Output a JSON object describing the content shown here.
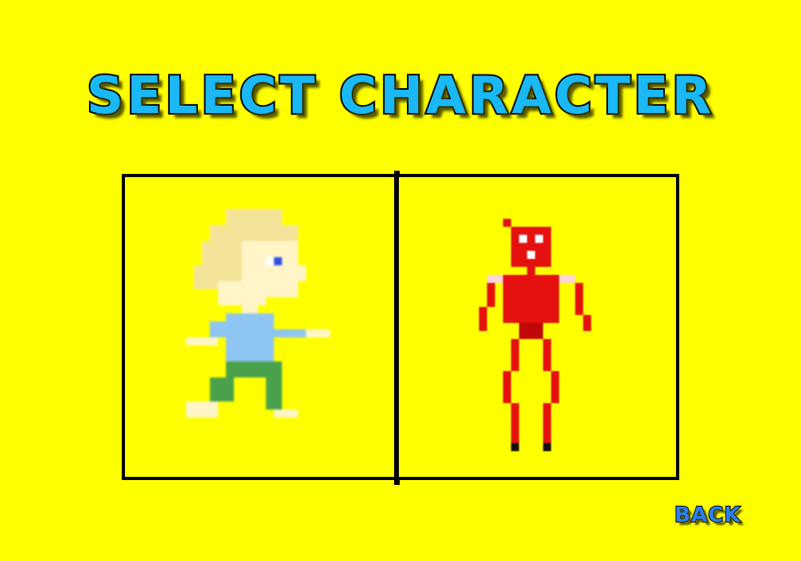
{
  "screen": {
    "title": "SELECT CHARACTER",
    "background_color": "#ffff00"
  },
  "characters": [
    {
      "id": "boy",
      "sprite": "blonde-boy-sprite",
      "colors": {
        "hair": "#f4e49a",
        "skin": "#fff6c8",
        "shirt": "#8fc5f2",
        "pants": "#49a14b",
        "eye": "#2f4ae0"
      }
    },
    {
      "id": "robot",
      "sprite": "red-robot-sprite",
      "colors": {
        "body": "#e51010",
        "eyes": "#ffffff",
        "feet": "#111111"
      }
    }
  ],
  "back_button": {
    "label": "BACK",
    "color": "#2a7ff0"
  }
}
